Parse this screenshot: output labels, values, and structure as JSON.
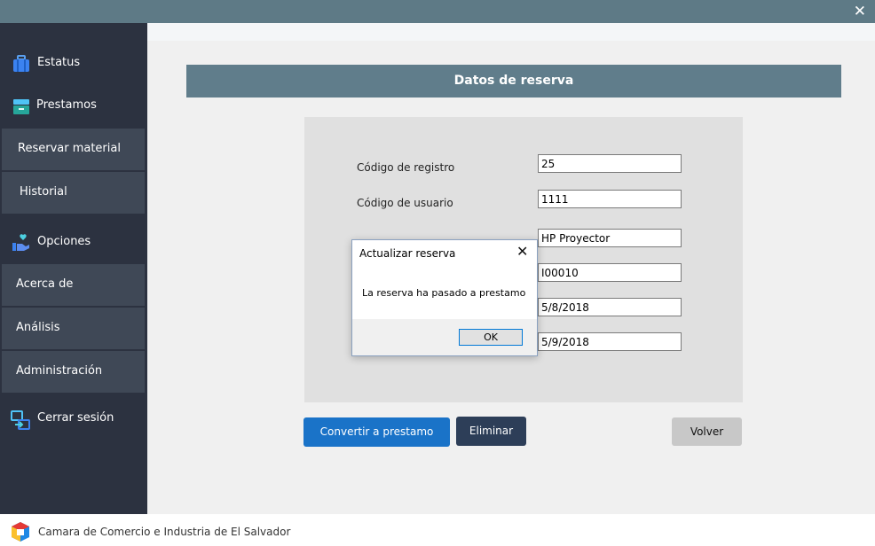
{
  "window": {
    "close_glyph": "✕"
  },
  "sidebar": {
    "sections": [
      {
        "label": "Estatus",
        "icon": "briefcase-icon"
      },
      {
        "label": "Prestamos",
        "icon": "drawer-icon"
      },
      {
        "label": "Opciones",
        "icon": "hand-heart-icon"
      },
      {
        "label": "Cerrar sesión",
        "icon": "logout-icon"
      }
    ],
    "items": [
      {
        "label": "Reservar material"
      },
      {
        "label": "Historial"
      },
      {
        "label": "Acerca de"
      },
      {
        "label": "Análisis"
      },
      {
        "label": "Administración"
      }
    ]
  },
  "main": {
    "header": "Datos de reserva",
    "form": {
      "fields": [
        {
          "label": "Código de registro",
          "value": "25"
        },
        {
          "label": "Código de usuario",
          "value": "1111"
        },
        {
          "value": "HP Proyector"
        },
        {
          "value": "I00010"
        },
        {
          "value": "5/8/2018"
        },
        {
          "value": "5/9/2018"
        }
      ]
    },
    "buttons": {
      "convert": "Convertir a prestamo",
      "delete": "Eliminar",
      "back": "Volver"
    }
  },
  "dialog": {
    "title": "Actualizar reserva",
    "close_glyph": "✕",
    "message": "La reserva ha pasado a prestamo",
    "ok": "OK"
  },
  "footer": {
    "text": "Camara de Comercio e Industria de El Salvador"
  },
  "colors": {
    "titlebar": "#5e7a86",
    "sidebar": "#2c3240",
    "sidebar_item": "#3f4856",
    "header_bar": "#607d8b",
    "primary_button": "#1a73c8",
    "dark_button": "#2d3e58"
  }
}
